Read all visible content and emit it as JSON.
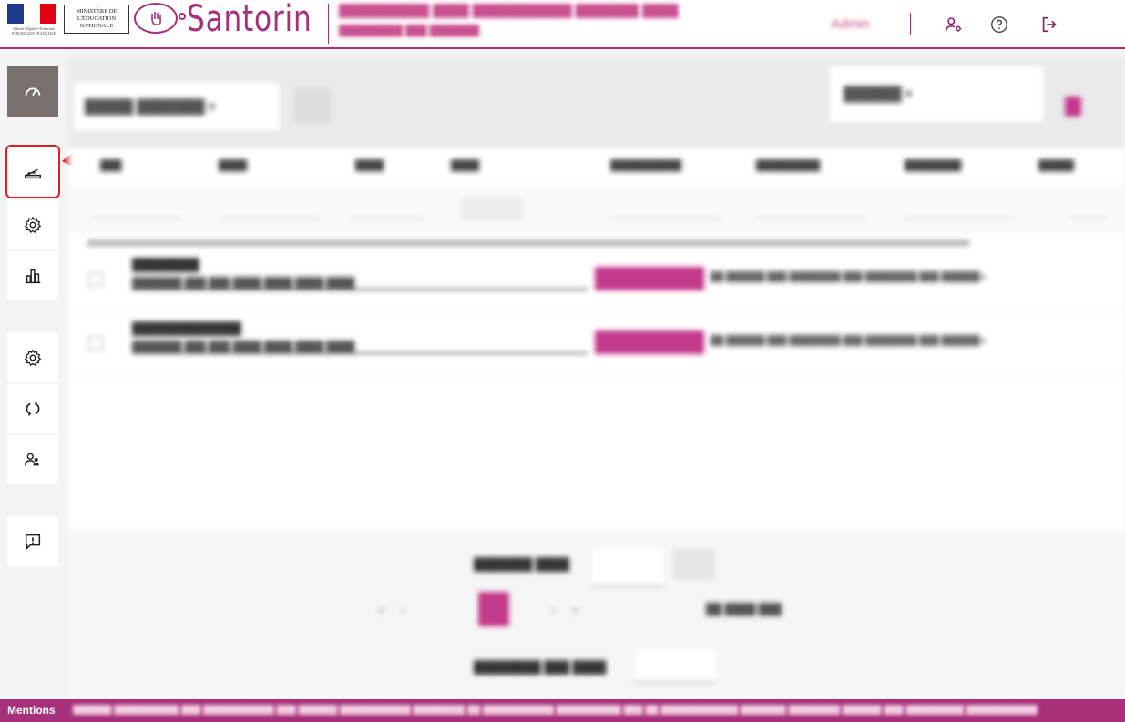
{
  "header": {
    "flag_motto": "Liberté • Égalité • Fraternité RÉPUBLIQUE FRANÇAISE",
    "ministry": "MINISTÈRE DE L'ÉDUCATION NATIONALE",
    "app_name": "Santorin",
    "role": "Admin"
  },
  "sidebar": {
    "items": [
      {
        "name": "dashboard",
        "icon": "gauge-icon"
      },
      {
        "name": "scanner",
        "icon": "scanner-icon"
      },
      {
        "name": "settings",
        "icon": "gear-icon"
      },
      {
        "name": "statistics",
        "icon": "bar-chart-icon"
      },
      {
        "name": "settings-2",
        "icon": "gear-icon"
      },
      {
        "name": "sync",
        "icon": "refresh-icon"
      },
      {
        "name": "users",
        "icon": "users-icon"
      },
      {
        "name": "feedback",
        "icon": "alert-message-icon"
      }
    ]
  },
  "footer": {
    "mentions": "Mentions"
  },
  "colors": {
    "brand": "#a7307a",
    "highlight": "#e01e2a"
  }
}
